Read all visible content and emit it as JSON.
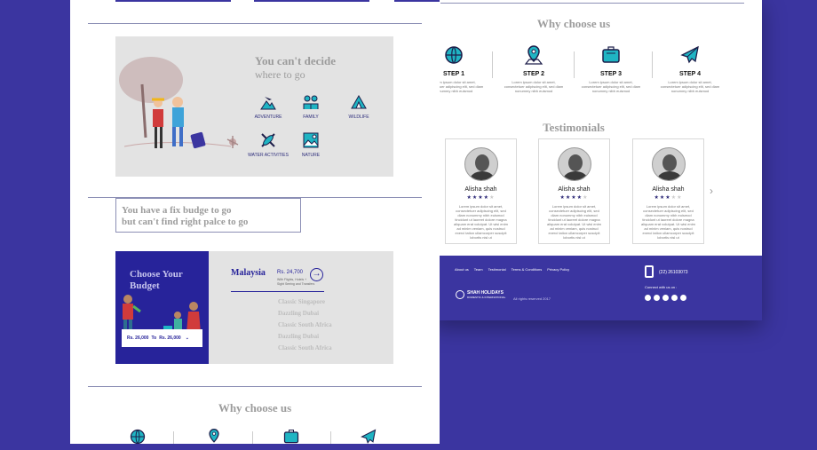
{
  "right": {
    "why_title": "Why choose us",
    "steps": [
      {
        "label": "STEP 1",
        "icon": "globe-icon"
      },
      {
        "label": "STEP 2",
        "icon": "map-pin-icon"
      },
      {
        "label": "STEP 3",
        "icon": "suitcase-icon"
      },
      {
        "label": "STEP 4",
        "icon": "airplane-icon"
      }
    ],
    "step_text": "Lorem ipsum dolor sit amet, consectetuer adipiscing elit, sed diam nonummy nibh euismod",
    "testimonials_title": "Testimonials",
    "testimonials": [
      {
        "name": "Alisha shah",
        "rating": 4
      },
      {
        "name": "Alisha shah",
        "rating": 4
      },
      {
        "name": "Alisha shah",
        "rating": 3
      }
    ],
    "testimonial_text": "Lorem ipsum dolor sit amet, consectetuer adipiscing elit, sed diam nonummy nibh euismod tincidunt ut laoreet dolore magna aliquam erat volutpat. Ut wisi enim ad minim veniam, quis nostrud exerci tation ullamcorper suscipit lobortis nisl ut",
    "footer": {
      "links": [
        "About us",
        "Team",
        "Testimonial",
        "Terms & Conditions",
        "Privacy Policy"
      ],
      "brand": "SHAH HOLIDAYS",
      "brand_sub": "DOMESTIC & INTERNATIONAL",
      "rights": "All rights reserved 2017",
      "phone": "(22) 26103073",
      "connect": "Connect with us on :"
    }
  },
  "left": {
    "decide_title_1": "You can't decide",
    "decide_title_2": "where to go",
    "categories": [
      {
        "label": "ADVENTURE",
        "icon": "mountain-plane-icon"
      },
      {
        "label": "FAMILY",
        "icon": "family-icon"
      },
      {
        "label": "WILDLIFE",
        "icon": "tent-icon"
      },
      {
        "label": "WATER ACTIVITIES",
        "icon": "kayak-icon"
      },
      {
        "label": "NATURE",
        "icon": "nature-icon"
      }
    ],
    "budget_line_1": "You have a fix budge to go",
    "budget_line_2": "but can't find right palce to go",
    "choose_title_1": "Choose Your",
    "choose_title_2": "Budget",
    "range_from": "Rs. 26,000",
    "range_to_word": "To",
    "range_to": "Rs. 26,000",
    "featured_dest": "Malaysia",
    "featured_price": "Rs. 24,700",
    "featured_note_1": "With Flights, Hotels +",
    "featured_note_2": "Sight Seeing and Transfers",
    "destinations": [
      "Classic Singapore",
      "Dazzling Dubai",
      "Classic South Africa",
      "Dazzling Dubai",
      "Classic South Africa"
    ],
    "why_title": "Why choose us"
  },
  "colors": {
    "brand": "#3b35a0",
    "teal": "#1fb4c3",
    "navy": "#1d1e4a"
  }
}
